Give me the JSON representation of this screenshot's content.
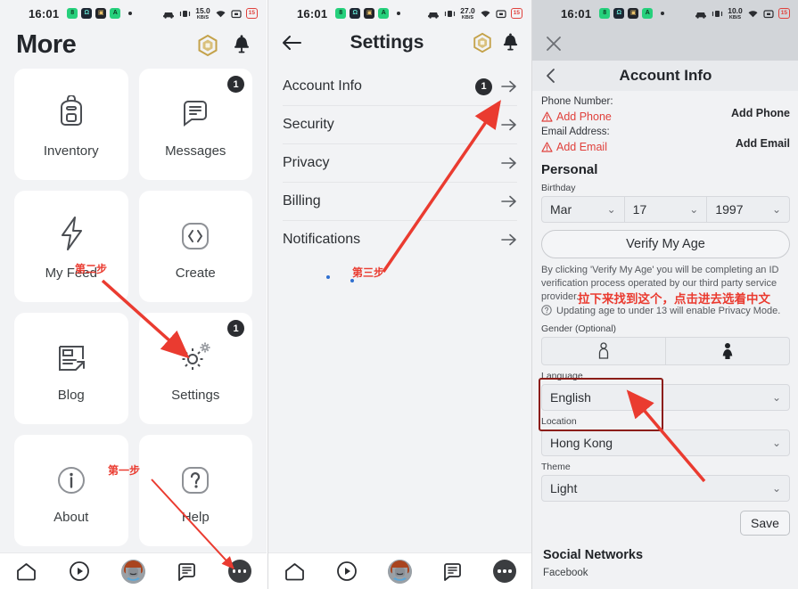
{
  "status_bar": {
    "time": "16:01",
    "app_icons": [
      "app-green-1",
      "app-dark-2",
      "app-black-3",
      "app-green-4"
    ],
    "net_speed_left": "15.0",
    "net_speed_mid": "27.0",
    "net_speed_right": "10.0",
    "speed_unit": "KB/S",
    "battery": "15",
    "icons": [
      "car-icon",
      "vibrate-icon",
      "wifi-icon",
      "screen-record-icon",
      "battery-icon"
    ]
  },
  "more_panel": {
    "title": "More",
    "header_icons": [
      "robux-icon",
      "notification-bell-icon"
    ],
    "tiles": [
      {
        "label": "Inventory",
        "icon": "backpack-icon",
        "badge": ""
      },
      {
        "label": "Messages",
        "icon": "message-icon",
        "badge": "1"
      },
      {
        "label": "My Feed",
        "icon": "lightning-icon",
        "badge": ""
      },
      {
        "label": "Create",
        "icon": "code-icon",
        "badge": ""
      },
      {
        "label": "Blog",
        "icon": "blog-icon",
        "badge": ""
      },
      {
        "label": "Settings",
        "icon": "gear-icon",
        "badge": "1"
      },
      {
        "label": "About",
        "icon": "info-icon",
        "badge": ""
      },
      {
        "label": "Help",
        "icon": "question-icon",
        "badge": ""
      }
    ],
    "bottom_nav": [
      "home-icon",
      "play-icon",
      "avatar-icon",
      "chat-icon",
      "more-dots-icon"
    ]
  },
  "settings_panel": {
    "title": "Settings",
    "header_icons": [
      "back-arrow-icon",
      "robux-icon",
      "notification-bell-icon"
    ],
    "rows": [
      {
        "label": "Account Info",
        "badge": "1",
        "chevron": "arrow-right-icon"
      },
      {
        "label": "Security",
        "badge": "",
        "chevron": "arrow-right-icon"
      },
      {
        "label": "Privacy",
        "badge": "",
        "chevron": "arrow-right-icon"
      },
      {
        "label": "Billing",
        "badge": "",
        "chevron": "arrow-right-icon"
      },
      {
        "label": "Notifications",
        "badge": "",
        "chevron": "arrow-right-icon"
      }
    ],
    "bottom_nav": [
      "home-icon",
      "play-icon",
      "avatar-icon",
      "chat-icon",
      "more-dots-icon"
    ]
  },
  "account_panel": {
    "close_icon": "close-icon",
    "back_icon": "chevron-left-icon",
    "title": "Account Info",
    "phone": {
      "label": "Phone Number:",
      "warning_icon": "warning-triangle-icon",
      "value": "Add Phone",
      "action": "Add Phone"
    },
    "email": {
      "label": "Email Address:",
      "warning_icon": "warning-triangle-icon",
      "value": "Add Email",
      "action": "Add Email"
    },
    "personal_title": "Personal",
    "birthday": {
      "label": "Birthday",
      "month": "Mar",
      "day": "17",
      "year": "1997"
    },
    "verify_button": "Verify My Age",
    "legal_text": "By clicking 'Verify My Age' you will be completing an ID verification process operated by our third party service provider.",
    "privacy_note": "Updating age to under 13 will enable Privacy Mode.",
    "privacy_icon": "question-circle-icon",
    "gender": {
      "label": "Gender (Optional)",
      "options": [
        "male-figure-icon",
        "female-figure-icon"
      ]
    },
    "language": {
      "label": "Language",
      "value": "English"
    },
    "location": {
      "label": "Location",
      "value": "Hong Kong"
    },
    "theme": {
      "label": "Theme",
      "value": "Light"
    },
    "save_button": "Save",
    "social_title": "Social Networks",
    "social_first": "Facebook"
  },
  "annotations": {
    "step1": "第一步",
    "step2": "第二步",
    "step3": "第三步",
    "language_note": "拉下来找到这个，点击进去选着中文",
    "arrow_color": "#ea3b30",
    "highlight_color": "#8c1d18"
  }
}
